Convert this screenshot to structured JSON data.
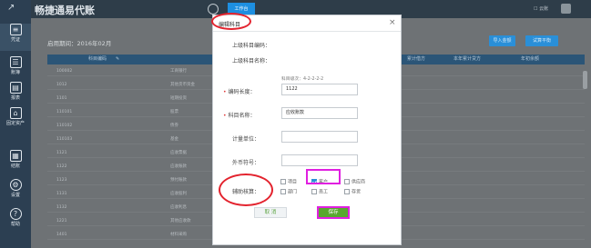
{
  "app": {
    "title": "畅捷通易代账"
  },
  "topbar": {
    "tab_label": "工作台",
    "right_label": "云账"
  },
  "sidebar": {
    "items": [
      {
        "label": "凭证",
        "icon": "voucher-icon"
      },
      {
        "label": "账簿",
        "icon": "ledger-icon"
      },
      {
        "label": "报表",
        "icon": "report-icon"
      },
      {
        "label": "固定资产",
        "icon": "asset-icon"
      },
      {
        "label": "结账",
        "icon": "closing-icon"
      },
      {
        "label": "设置",
        "icon": "settings-icon"
      },
      {
        "label": "帮助",
        "icon": "help-icon"
      }
    ]
  },
  "main": {
    "period_label": "启用期间：2016年02月",
    "buttons": {
      "import": "导入金额",
      "trial_balance": "试算平衡"
    },
    "table": {
      "headers": [
        "科目编码",
        "累计借方",
        "本年累计贷方",
        "年初余额"
      ],
      "rows": [
        {
          "code": "100002",
          "name": "工商银行"
        },
        {
          "code": "1012",
          "name": "其他货币资金"
        },
        {
          "code": "1101",
          "name": "短期投资"
        },
        {
          "code": "110101",
          "name": "股票"
        },
        {
          "code": "110102",
          "name": "债券"
        },
        {
          "code": "110103",
          "name": "基金"
        },
        {
          "code": "1121",
          "name": "应收票据"
        },
        {
          "code": "1122",
          "name": "应收账款"
        },
        {
          "code": "1123",
          "name": "预付账款"
        },
        {
          "code": "1131",
          "name": "应收股利"
        },
        {
          "code": "1132",
          "name": "应收利息"
        },
        {
          "code": "1221",
          "name": "其他应收款"
        },
        {
          "code": "1401",
          "name": "材料采购"
        }
      ]
    }
  },
  "modal": {
    "title": "编辑科目",
    "close_glyph": "×",
    "parent_code_label": "上级科目编码：",
    "parent_name_label": "上级科目名称：",
    "level_hint": "科目级次：4-2-2-2-2",
    "code_length_label": "编码长度：",
    "code_value": "1122",
    "name_label": "科目名称：",
    "name_value": "应收账款",
    "unit_label": "计量单位：",
    "currency_label": "外币符号：",
    "aux_label": "辅助核算：",
    "aux_options": [
      {
        "label": "项目",
        "checked": false
      },
      {
        "label": "客户",
        "checked": true
      },
      {
        "label": "供应商",
        "checked": false
      },
      {
        "label": "部门",
        "checked": false
      },
      {
        "label": "员工",
        "checked": false
      },
      {
        "label": "存货",
        "checked": false
      }
    ],
    "cancel_label": "取 消",
    "save_label": "保存"
  },
  "colors": {
    "accent_blue": "#2a8fd8",
    "save_green": "#58a82e",
    "annotation_red": "#e3232e",
    "annotation_magenta": "#e020e0"
  }
}
